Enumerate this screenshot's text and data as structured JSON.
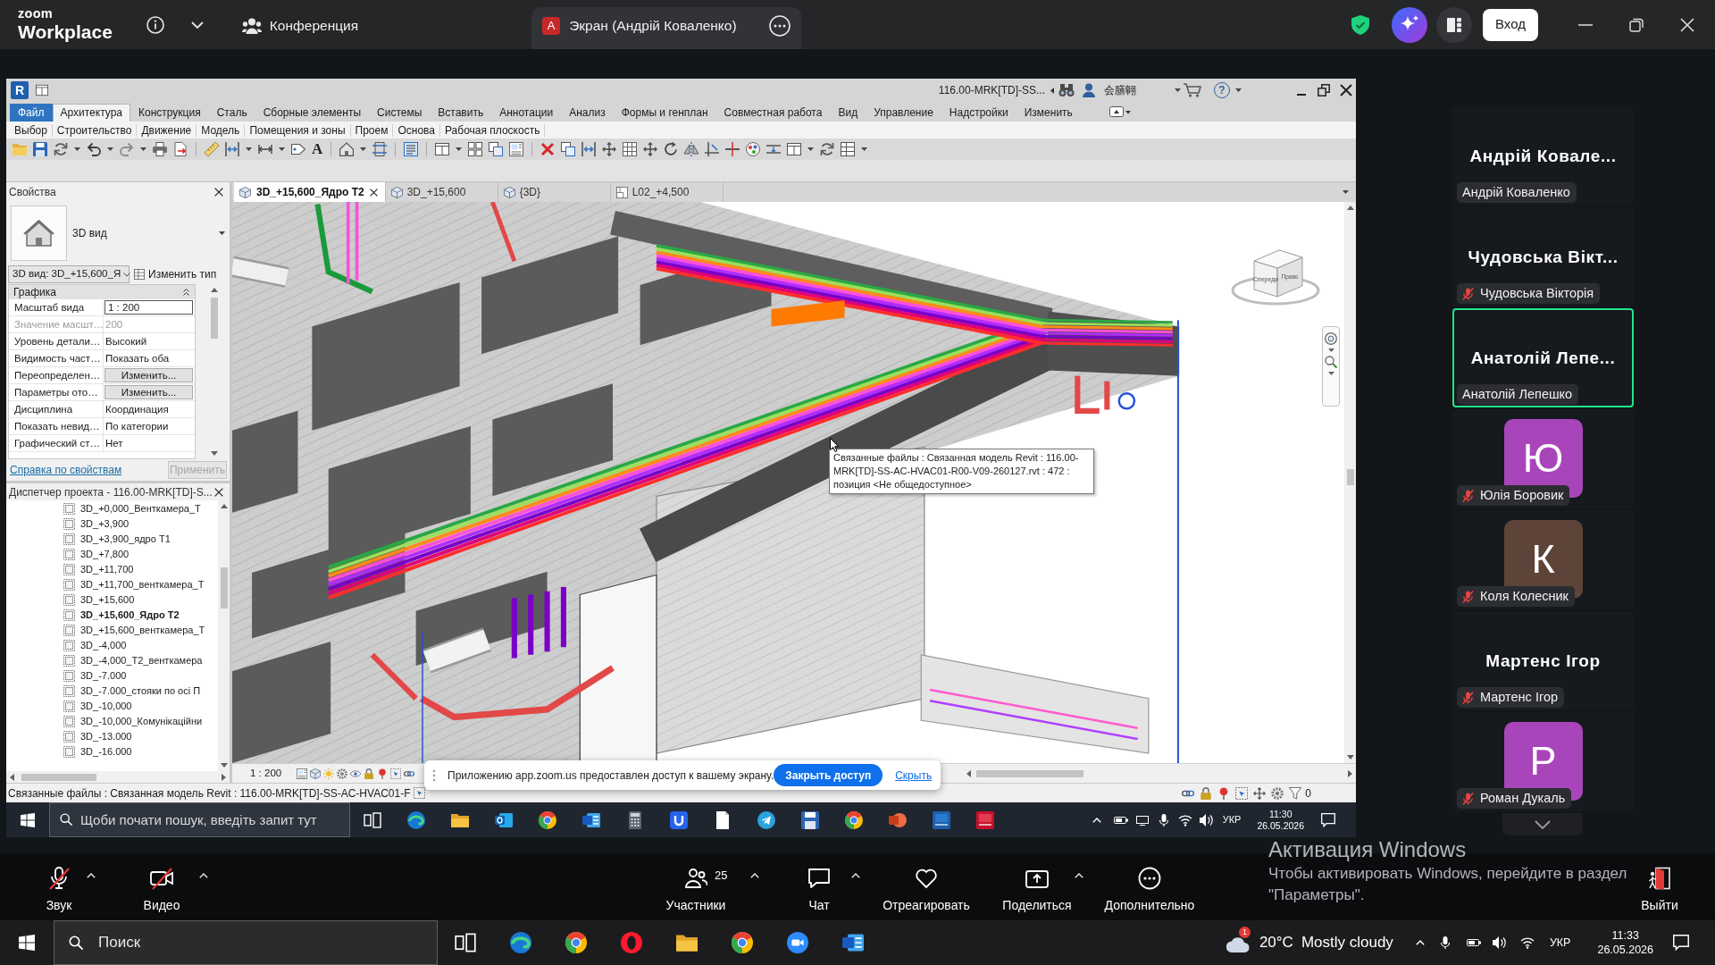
{
  "zoom_titlebar": {
    "logo_small": "zoom",
    "logo_large": "Workplace",
    "tabs": [
      {
        "kind": "meeting",
        "label": "Конференция",
        "selected": false
      },
      {
        "kind": "share",
        "initial": "А",
        "label": "Экран (Андрій Коваленко)",
        "selected": true
      }
    ],
    "signin_button": "Вход"
  },
  "revit_window": {
    "logo": "R",
    "title": "116.00-MRK[TD]-SS...",
    "user": "会膳翺",
    "help": "?",
    "ribbon_tabs": [
      {
        "kind": "file",
        "label": "Файл",
        "selected": false
      },
      {
        "kind": "tab",
        "label": "Архитектура",
        "selected": true
      },
      {
        "kind": "tab",
        "label": "Конструкция",
        "selected": false
      },
      {
        "kind": "tab",
        "label": "Сталь",
        "selected": false
      },
      {
        "kind": "tab",
        "label": "Сборные элементы",
        "selected": false
      },
      {
        "kind": "tab",
        "label": "Системы",
        "selected": false
      },
      {
        "kind": "tab",
        "label": "Вставить",
        "selected": false
      },
      {
        "kind": "tab",
        "label": "Аннотации",
        "selected": false
      },
      {
        "kind": "tab",
        "label": "Анализ",
        "selected": false
      },
      {
        "kind": "tab",
        "label": "Формы и генплан",
        "selected": false
      },
      {
        "kind": "tab",
        "label": "Совместная работа",
        "selected": false
      },
      {
        "kind": "tab",
        "label": "Вид",
        "selected": false
      },
      {
        "kind": "tab",
        "label": "Управление",
        "selected": false
      },
      {
        "kind": "tab",
        "label": "Надстройки",
        "selected": false
      },
      {
        "kind": "tab",
        "label": "Изменить",
        "selected": false
      }
    ],
    "ribbon_panels": [
      "Выбор",
      "Строительство",
      "Движение",
      "Модель",
      "Помещения и зоны",
      "Проем",
      "Основа",
      "Рабочая плоскость"
    ],
    "text_tool": "A",
    "properties": {
      "title": "Свойства",
      "type_name": "3D вид",
      "instance": "3D вид: 3D_+15,600_Я",
      "edit_type": "Изменить тип",
      "group": "Графика",
      "rows": [
        {
          "kind": "input",
          "label": "Масштаб вида",
          "value": "1 : 200",
          "disabled": false
        },
        {
          "kind": "text",
          "label": "Значение масшт…",
          "value": "200",
          "disabled": true
        },
        {
          "kind": "text",
          "label": "Уровень детали…",
          "value": "Высокий",
          "disabled": false
        },
        {
          "kind": "text",
          "label": "Видимость част…",
          "value": "Показать оба",
          "disabled": false
        },
        {
          "kind": "button",
          "label": "Переопределен…",
          "value": "Изменить...",
          "disabled": false
        },
        {
          "kind": "button",
          "label": "Параметры ото…",
          "value": "Изменить...",
          "disabled": false
        },
        {
          "kind": "text",
          "label": "Дисциплина",
          "value": "Координация",
          "disabled": false
        },
        {
          "kind": "text",
          "label": "Показать невид…",
          "value": "По категории",
          "disabled": false
        },
        {
          "kind": "text",
          "label": "Графический ст…",
          "value": "Нет",
          "disabled": false
        }
      ],
      "help_link": "Справка по свойствам",
      "apply_button": "Применить",
      "apply_disabled": true
    },
    "project_browser": {
      "title": "Диспетчер проекта - 116.00-MRK[TD]-S...",
      "items": [
        {
          "label": "3D_+0,000_Венткамера_Т",
          "selected": false
        },
        {
          "label": "3D_+3,900",
          "selected": false
        },
        {
          "label": "3D_+3,900_ядро Т1",
          "selected": false
        },
        {
          "label": "3D_+7,800",
          "selected": false
        },
        {
          "label": "3D_+11,700",
          "selected": false
        },
        {
          "label": "3D_+11,700_венткамера_Т",
          "selected": false
        },
        {
          "label": "3D_+15,600",
          "selected": false
        },
        {
          "label": "3D_+15,600_Ядро Т2",
          "selected": true
        },
        {
          "label": "3D_+15,600_венткамера_Т",
          "selected": false
        },
        {
          "label": "3D_-4,000",
          "selected": false
        },
        {
          "label": "3D_-4,000_Т2_венткамера",
          "selected": false
        },
        {
          "label": "3D_-7.000",
          "selected": false
        },
        {
          "label": "3D_-7.000_стояки по осі П",
          "selected": false
        },
        {
          "label": "3D_-10,000",
          "selected": false
        },
        {
          "label": "3D_-10,000_Комунікаційни",
          "selected": false
        },
        {
          "label": "3D_-13.000",
          "selected": false
        },
        {
          "label": "3D_-16.000",
          "selected": false
        }
      ]
    },
    "view_tabs": [
      {
        "kind": "model",
        "label": "3D_+15,600_Ядро Т2",
        "selected": true
      },
      {
        "kind": "model",
        "label": "3D_+15,600",
        "selected": false
      },
      {
        "kind": "model",
        "label": "{3D}",
        "selected": false
      },
      {
        "kind": "plan",
        "label": "L02_+4,500",
        "selected": false
      }
    ],
    "view": {
      "tooltip": "Связанные файлы : Связанная модель Revit : 116.00-MRK[TD]-SS-AC-HVAC01-R00-V09-260127.rvt : 472 : позиция <Не общедоступное>",
      "cube_front": "Спереди",
      "cube_right": "Право",
      "scale": "1 : 200"
    },
    "status_bar": {
      "text": "Связанные файлы : Связанная модель Revit : 116.00-MRK[TD]-SS-AC-HVAC01-F",
      "selection_count": "0"
    }
  },
  "share_notice": {
    "text": "Приложению app.zoom.us предоставлен доступ к вашему экрану.",
    "stop_button": "Закрыть доступ",
    "hide_link": "Скрыть"
  },
  "remote_taskbar": {
    "search_placeholder": "Щоби почати пошук, введіть запит тут",
    "language": "УКР",
    "time": "11:30",
    "date": "26.05.2026"
  },
  "participants": [
    {
      "kind": "name",
      "title": "Андрій Ковале...",
      "name": "Андрій Коваленко",
      "muted": false,
      "speaking": false
    },
    {
      "kind": "name",
      "title": "Чудовська Вікт...",
      "name": "Чудовська Вікторія",
      "muted": true,
      "speaking": false
    },
    {
      "kind": "name",
      "title": "Анатолій Лепе...",
      "name": "Анатолій Лепешко",
      "muted": false,
      "speaking": true
    },
    {
      "kind": "avatar",
      "initial": "Ю",
      "color": "#a945ba",
      "name": "Юлія Боровик",
      "muted": true,
      "speaking": false
    },
    {
      "kind": "avatar",
      "initial": "К",
      "color": "#5e4339",
      "name": "Коля Колесник",
      "muted": true,
      "speaking": false
    },
    {
      "kind": "name",
      "title": "Мартенс Ігор",
      "name": "Мартенс Ігор",
      "muted": true,
      "speaking": false
    },
    {
      "kind": "avatar",
      "initial": "Р",
      "color": "#a945ba",
      "name": "Роман Дукаль",
      "muted": true,
      "speaking": false
    }
  ],
  "zoom_toolbar": {
    "items": [
      {
        "kind": "audio",
        "label": "Звук",
        "off": true,
        "caret": true
      },
      {
        "kind": "video",
        "label": "Видео",
        "off": true,
        "caret": true
      },
      {
        "kind": "participants",
        "label": "Участники",
        "count": "25",
        "off": false,
        "caret": true
      },
      {
        "kind": "chat",
        "label": "Чат",
        "off": false,
        "caret": true
      },
      {
        "kind": "react",
        "label": "Отреагировать",
        "off": false,
        "caret": false
      },
      {
        "kind": "share",
        "label": "Поделиться",
        "off": false,
        "caret": true
      },
      {
        "kind": "more",
        "label": "Дополнительно",
        "off": false,
        "caret": false
      }
    ],
    "leave": "Выйти"
  },
  "windows_activation": {
    "title": "Активация Windows",
    "text": "Чтобы активировать Windows, перейдите в раздел \"Параметры\"."
  },
  "host_taskbar": {
    "search_placeholder": "Поиск",
    "weather": {
      "badge": "1",
      "temperature": "20°C",
      "condition": "Mostly cloudy"
    },
    "language": "УКР",
    "time": "11:33",
    "date": "26.05.2026"
  }
}
